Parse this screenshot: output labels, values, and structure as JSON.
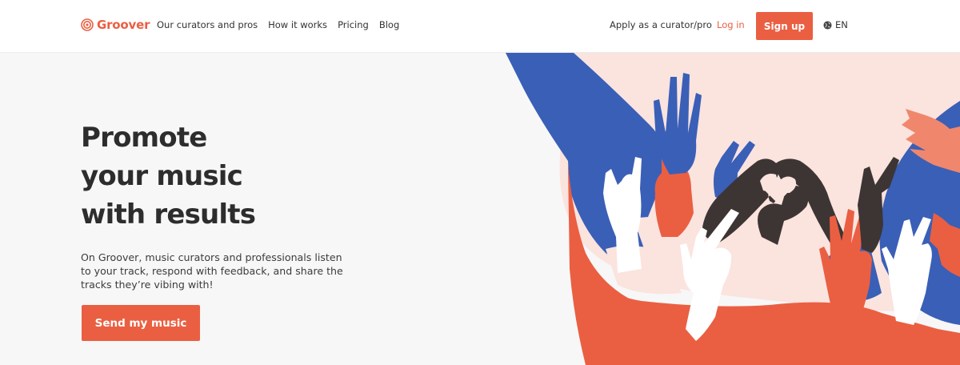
{
  "brand": {
    "name": "Groover",
    "accent": "#ea5f42",
    "blue": "#3a5fb7",
    "dark": "#3d3534",
    "pink": "#fae0db"
  },
  "nav": {
    "links": [
      "Our curators and pros",
      "How it works",
      "Pricing",
      "Blog"
    ],
    "apply": "Apply as a curator/pro",
    "login": "Log in",
    "signup": "Sign up",
    "language": "EN",
    "language_icon": "globe-icon"
  },
  "hero": {
    "title_lines": [
      "Promote",
      "your music",
      "with results"
    ],
    "description": "On Groover, music curators and professionals listen to your track, respond with feedback, and share the tracks they’re vibing with!",
    "cta": "Send my music"
  }
}
